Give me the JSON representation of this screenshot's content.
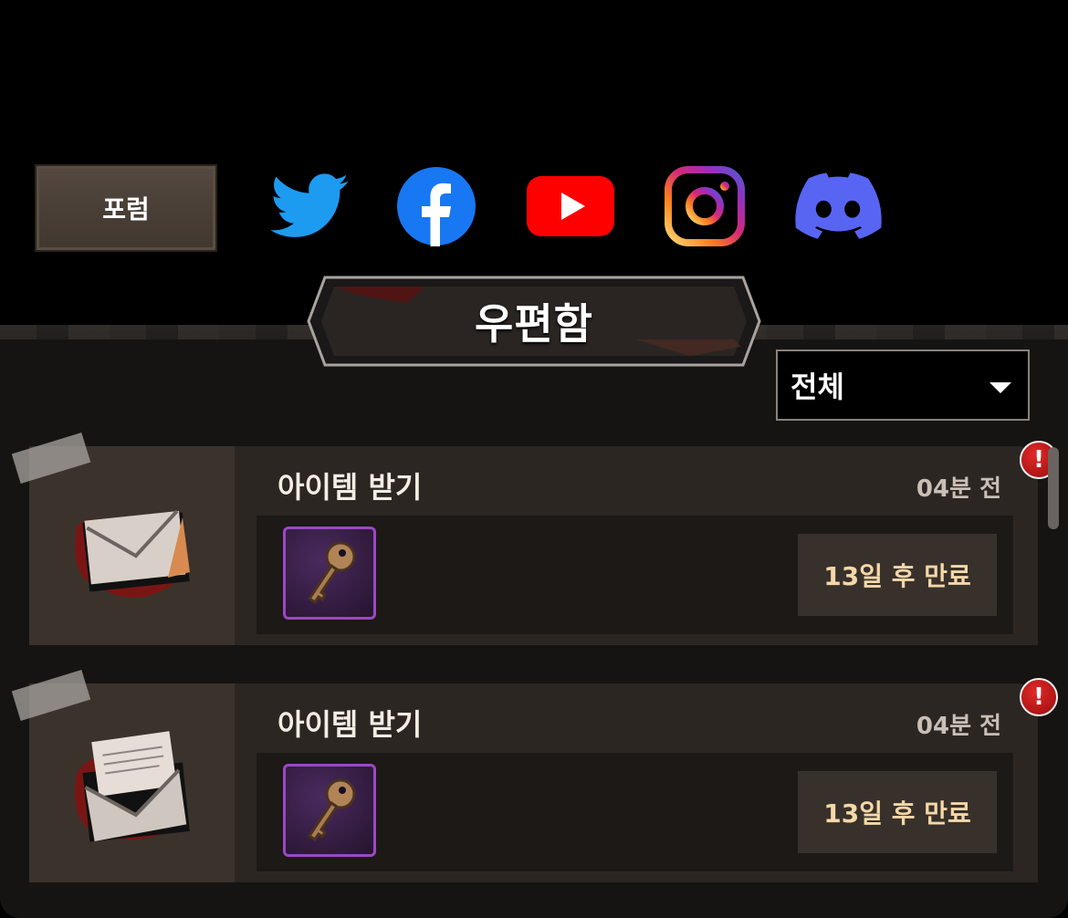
{
  "social": {
    "forum_label": "포럼",
    "icons": [
      "twitter-icon",
      "facebook-icon",
      "youtube-icon",
      "instagram-icon",
      "discord-icon"
    ]
  },
  "mailbox": {
    "title": "우편함",
    "filter_label": "전체"
  },
  "mails": [
    {
      "title": "아이템 받기",
      "time": "04분 전",
      "expire": "13일 후 만료",
      "item": "key-icon",
      "alert": "!"
    },
    {
      "title": "아이템 받기",
      "time": "04분 전",
      "expire": "13일 후 만료",
      "item": "key-icon",
      "alert": "!"
    }
  ],
  "colors": {
    "accent_purple": "#9c47c4",
    "expire_text": "#f5d7a8",
    "alert_red": "#c0141a"
  }
}
